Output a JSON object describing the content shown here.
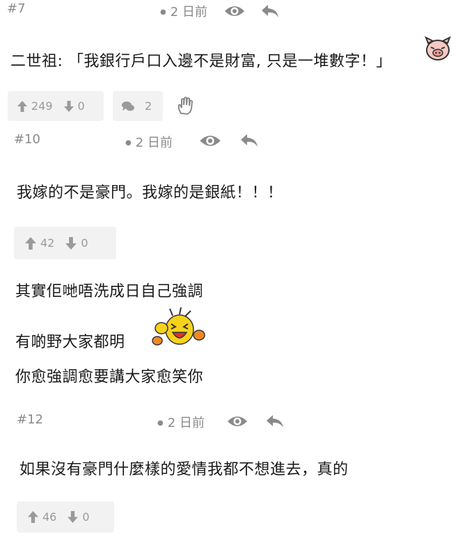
{
  "posts": [
    {
      "number": "#7",
      "time": "2 日前",
      "message": "二世祖: 「我銀行戶口入邊不是財富, 只是一堆數字！」",
      "upvotes": "249",
      "downvotes": "0",
      "comments": "2"
    },
    {
      "number": "#10",
      "time": "2 日前",
      "message": "我嫁的不是豪門。我嫁的是銀紙！！！",
      "upvotes": "42",
      "downvotes": "0",
      "quote_lines": [
        "其實佢哋唔洗成日自己強調",
        "有啲野大家都明",
        "你愈強調愈要講大家愈笑你"
      ]
    },
    {
      "number": "#12",
      "time": "2 日前",
      "message": "如果沒有豪門什麼樣的愛情我都不想進去，真的",
      "upvotes": "46",
      "downvotes": "0"
    }
  ],
  "colors": {
    "meta_text": "#8a8a8a",
    "box_bg": "#f2f2f2",
    "emoji_yellow": "#f7d21c"
  },
  "icons": [
    "eye-icon",
    "reply-icon",
    "upvote-icon",
    "downvote-icon",
    "comment-icon",
    "hand-icon",
    "pig-emoji-icon",
    "laughing-emoji-icon"
  ]
}
